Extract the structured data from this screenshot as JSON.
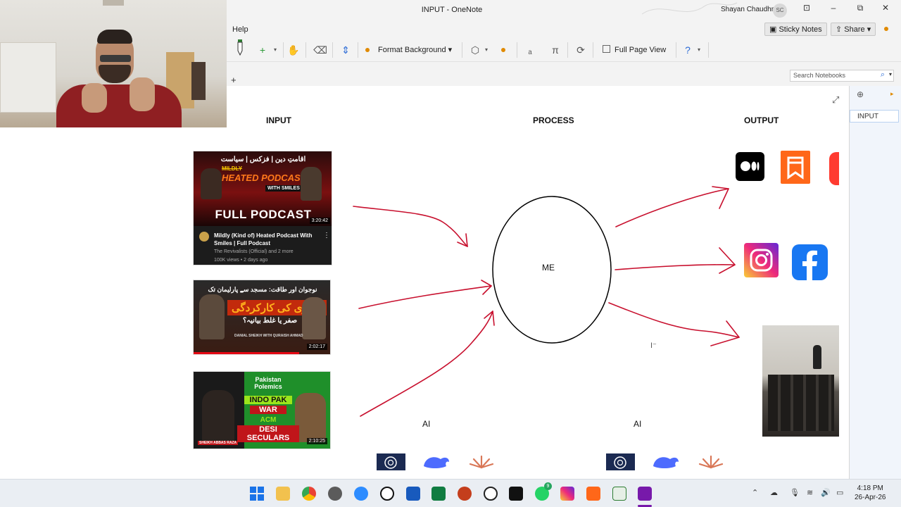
{
  "window": {
    "title": "INPUT - OneNote",
    "user_name": "Shayan Chaudhry",
    "user_initials": "SC"
  },
  "menubar": {
    "help": "Help",
    "sticky_notes": "Sticky Notes",
    "share": "Share"
  },
  "toolbar": {
    "format_background": "Format Background",
    "full_page_view": "Full Page View"
  },
  "search": {
    "placeholder": "Search Notebooks"
  },
  "pages": [
    {
      "title": "INPUT"
    }
  ],
  "canvas": {
    "input_label": "INPUT",
    "process_label": "PROCESS",
    "output_label": "OUTPUT",
    "me_label": "ME",
    "ai_label_left": "AI",
    "ai_label_right": "AI"
  },
  "videos": [
    {
      "headline_urdu": "اقامتِ دین | فزکس | سیاست",
      "strike": "MILDLY",
      "title_main": "HEATED PODCAST",
      "with_smiles": "WITH SMILES",
      "banner": "FULL PODCAST",
      "duration": "3:20:42",
      "video_title": "Mildly (Kind of) Heated Podcast With Smiles | Full Podcast",
      "channel": "The Revivalists (Official) and 2 more",
      "meta": "100K views • 2 days ago"
    },
    {
      "headline_urdu": "نوجوان اور طاقت: مسجد سے پارلیمان تک",
      "line2_urdu": "مولوی کی کارکردگی",
      "line3_urdu": "صفر یا غلط بیانیہ؟",
      "caption": "DANIAL SHEIKH WITH QURAISH AHMAD",
      "duration": "2:02:17"
    },
    {
      "brand": "Pakistan Polemics",
      "line1": "INDO PAK",
      "line2": "WAR",
      "line3": "ACM",
      "line4": "DESI SECULARS",
      "name_tag": "SHEIKH ABBAS RAZA",
      "duration": "2:10:25"
    }
  ],
  "taskbar": {
    "time": "4:18 PM",
    "date": "26-Apr-26",
    "whatsapp_badge": "9"
  },
  "colors": {
    "arrow": "#c8102e",
    "ellipse": "#000000",
    "onenote": "#7719aa"
  }
}
